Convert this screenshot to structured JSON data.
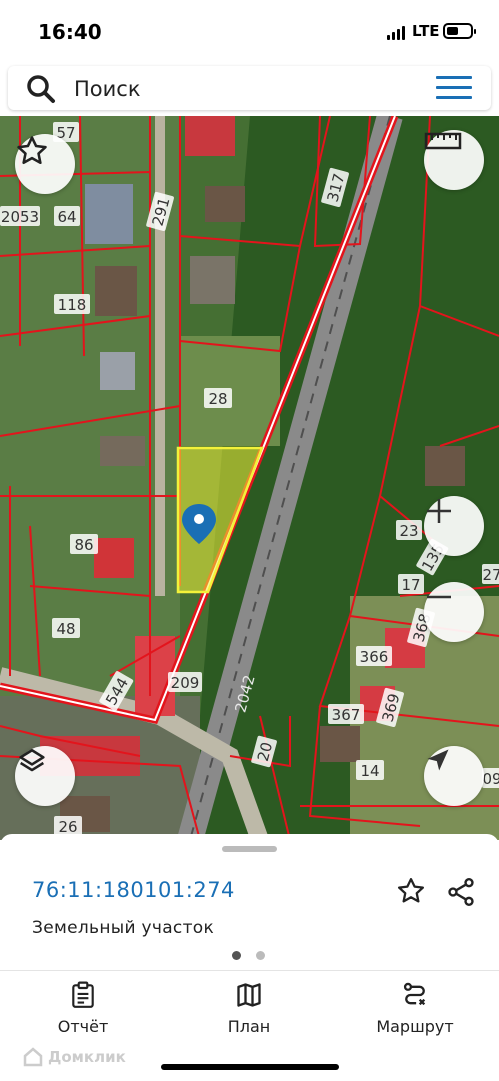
{
  "status_bar": {
    "time": "16:40",
    "network": "LTE"
  },
  "search": {
    "placeholder": "Поиск"
  },
  "map": {
    "plot_labels": [
      "57",
      "2053",
      "64",
      "291",
      "317",
      "118",
      "28",
      "86",
      "48",
      "544",
      "23",
      "135",
      "27",
      "17",
      "366",
      "368",
      "367",
      "369",
      "20",
      "14",
      "26",
      "209",
      "09"
    ],
    "road_label": "2042",
    "highlight_color": "#f3f23a",
    "border_color": "#e3141c"
  },
  "sheet": {
    "cadastral_number": "76:11:180101:274",
    "parcel_type": "Земельный участок",
    "page_count": 2,
    "active_page": 1
  },
  "bottom_nav": {
    "items": [
      {
        "label": "Отчёт",
        "icon": "report-icon"
      },
      {
        "label": "План",
        "icon": "map-icon"
      },
      {
        "label": "Маршрут",
        "icon": "route-icon"
      }
    ]
  },
  "watermark": "Домклик",
  "colors": {
    "accent": "#1a6fb5",
    "map_border": "#e3141c",
    "selection": "#f3f23a"
  }
}
